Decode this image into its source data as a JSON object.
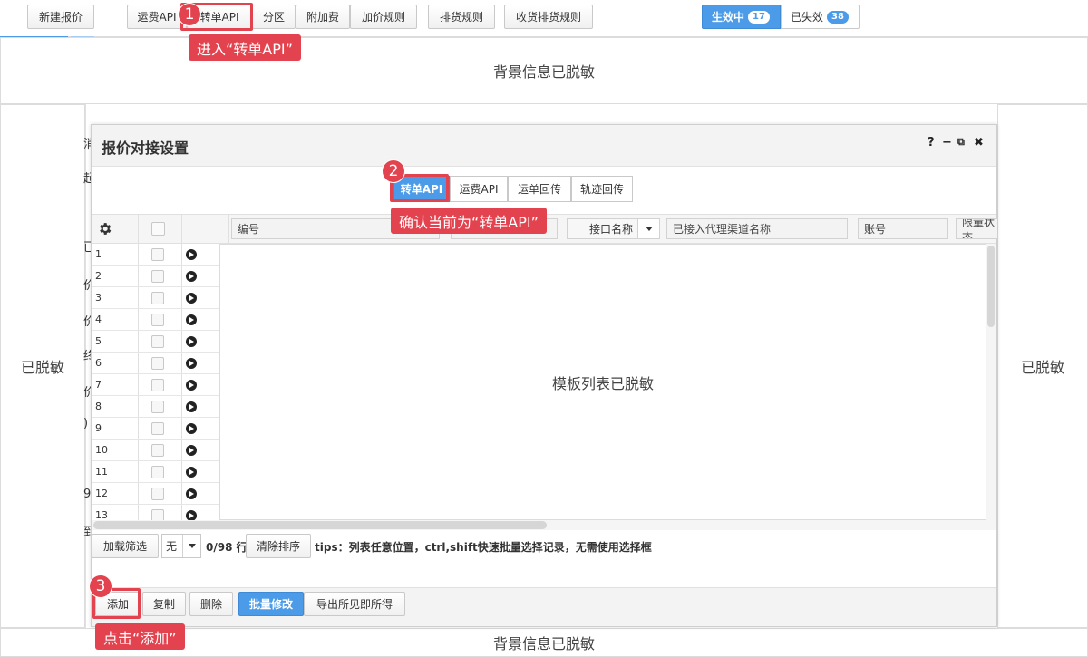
{
  "topbar": {
    "new_quote": "新建报价",
    "tabs": [
      "运费API",
      "转单API",
      "分区",
      "附加费",
      "加价规则"
    ],
    "pickup_rules": "排货规则",
    "receive_pickup_rules": "收货排货规则",
    "status": {
      "active_label": "生效中",
      "active_count": "17",
      "expired_label": "已失效",
      "expired_count": "38"
    }
  },
  "masks": {
    "top": "背景信息已脱敏",
    "bottom": "背景信息已脱敏",
    "left": "已脱敏",
    "right": "已脱敏",
    "list": "模板列表已脱敏"
  },
  "left_fragments": [
    "消",
    "起",
    "已",
    "价",
    "价",
    "终",
    "价",
    ")",
    "9",
    "到"
  ],
  "dialog": {
    "title": "报价对接设置",
    "help": "?",
    "minimize": "−",
    "popout": "⧉",
    "close": "✖",
    "subtabs": [
      "转单API",
      "运费API",
      "运单回传",
      "轨迹回传"
    ],
    "columns": {
      "code": "编号",
      "interface_name": "接口名称",
      "channel_name": "已接入代理渠道名称",
      "account": "账号",
      "limit_status": "限量状态"
    },
    "rows": [
      "1",
      "2",
      "3",
      "4",
      "5",
      "6",
      "7",
      "8",
      "9",
      "10",
      "11",
      "12",
      "13"
    ],
    "footer": {
      "load_filter": "加载筛选",
      "filter_value": "无",
      "count": "0/98 行",
      "clear_sort": "清除排序",
      "tips": "tips：列表任意位置，ctrl,shift快速批量选择记录，无需使用选择框"
    },
    "actions": {
      "add": "添加",
      "copy": "复制",
      "delete": "删除",
      "batch_edit": "批量修改",
      "export": "导出所见即所得"
    }
  },
  "annotations": {
    "step1_num": "1",
    "step1_text": "进入“转单API”",
    "step2_num": "2",
    "step2_text": "确认当前为“转单API”",
    "step3_num": "3",
    "step3_text": "点击“添加”"
  },
  "colors": {
    "accent": "#4b9be8",
    "annotation": "#e3434e"
  }
}
